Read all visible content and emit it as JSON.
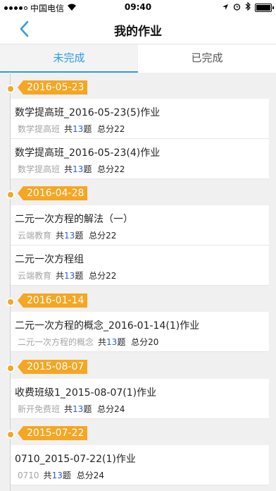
{
  "status_bar": {
    "carrier": "中国电信",
    "time": "09:40"
  },
  "nav": {
    "title": "我的作业",
    "back_icon": "chevron-left-icon"
  },
  "tabs": [
    {
      "label": "未完成",
      "active": true
    },
    {
      "label": "已完成",
      "active": false
    }
  ],
  "colors": {
    "accent": "#2c9be8",
    "date_tag": "#f5a623",
    "count": "#2d5fd0"
  },
  "groups": [
    {
      "date": "2016-05-23",
      "items": [
        {
          "title": "数学提高班_2016-05-23(5)作业",
          "source": "数学提高班",
          "count_prefix": "共",
          "count": "13",
          "count_suffix": "题",
          "total": "总分22"
        },
        {
          "title": "数学提高班_2016-05-23(4)作业",
          "source": "数学提高班",
          "count_prefix": "共",
          "count": "13",
          "count_suffix": "题",
          "total": "总分22"
        }
      ]
    },
    {
      "date": "2016-04-28",
      "items": [
        {
          "title": "二元一次方程的解法（一）",
          "source": "云端教育",
          "count_prefix": "共",
          "count": "13",
          "count_suffix": "题",
          "total": "总分22"
        },
        {
          "title": "二元一次方程组",
          "source": "云端教育",
          "count_prefix": "共",
          "count": "13",
          "count_suffix": "题",
          "total": "总分22"
        }
      ]
    },
    {
      "date": "2016-01-14",
      "items": [
        {
          "title": "二元一次方程的概念_2016-01-14(1)作业",
          "source": "二元一次方程的概念",
          "count_prefix": "共",
          "count": "13",
          "count_suffix": "题",
          "total": "总分20"
        }
      ]
    },
    {
      "date": "2015-08-07",
      "items": [
        {
          "title": "收费班级1_2015-08-07(1)作业",
          "source": "新开免费班",
          "count_prefix": "共",
          "count": "13",
          "count_suffix": "题",
          "total": "总分24"
        }
      ]
    },
    {
      "date": "2015-07-22",
      "items": [
        {
          "title": "0710_2015-07-22(1)作业",
          "source": "0710",
          "count_prefix": "共",
          "count": "13",
          "count_suffix": "题",
          "total": "总分24"
        }
      ]
    }
  ]
}
